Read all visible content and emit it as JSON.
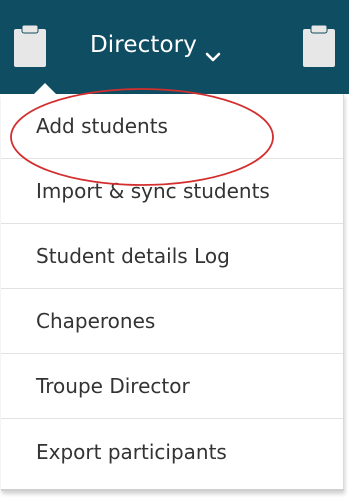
{
  "header": {
    "title": "Directory",
    "background_color": "#0f4d62",
    "left_icon": "clipboard-icon",
    "right_icon": "clipboard-icon",
    "dropdown_icon": "chevron-down-icon"
  },
  "menu": {
    "items": [
      {
        "label": "Add students"
      },
      {
        "label": "Import & sync students"
      },
      {
        "label": "Student details Log"
      },
      {
        "label": "Chaperones"
      },
      {
        "label": "Troupe Director"
      },
      {
        "label": "Export participants"
      }
    ]
  },
  "annotation": {
    "shape": "ellipse",
    "color": "#d32f2f",
    "target": "Add students"
  }
}
